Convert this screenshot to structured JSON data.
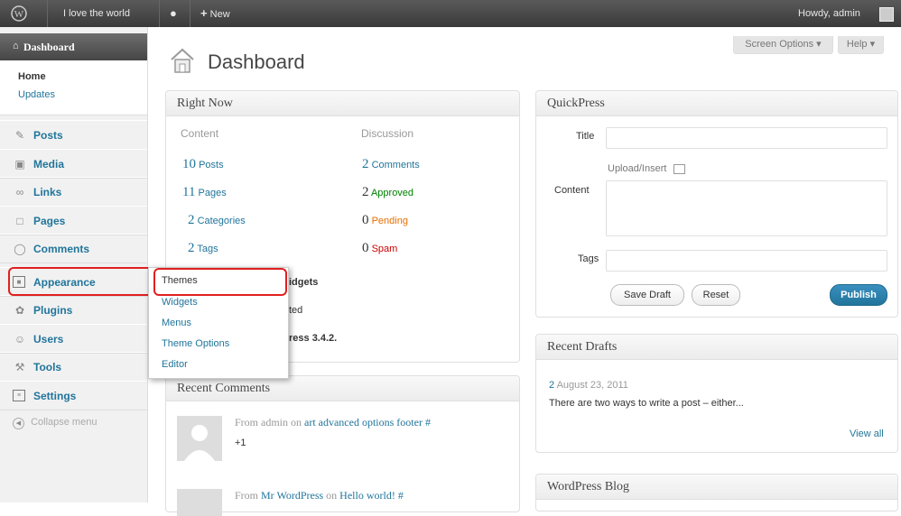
{
  "adminbar": {
    "site_name": "I love the world",
    "new_label": "New",
    "howdy": "Howdy, admin"
  },
  "header": {
    "title": "Dashboard",
    "screen_options": "Screen Options ▾",
    "help": "Help ▾"
  },
  "sidebar": {
    "dashboard": "Dashboard",
    "home": "Home",
    "updates": "Updates",
    "items": [
      {
        "label": "Posts",
        "icon": "posts-icon"
      },
      {
        "label": "Media",
        "icon": "media-icon"
      },
      {
        "label": "Links",
        "icon": "links-icon"
      },
      {
        "label": "Pages",
        "icon": "pages-icon"
      },
      {
        "label": "Comments",
        "icon": "comments-icon"
      },
      {
        "label": "Appearance",
        "icon": "appearance-icon"
      },
      {
        "label": "Plugins",
        "icon": "plugins-icon"
      },
      {
        "label": "Users",
        "icon": "users-icon"
      },
      {
        "label": "Tools",
        "icon": "tools-icon"
      },
      {
        "label": "Settings",
        "icon": "settings-icon"
      }
    ],
    "collapse": "Collapse menu"
  },
  "flyout": {
    "items": [
      "Themes",
      "Widgets",
      "Menus",
      "Theme Options",
      "Editor"
    ]
  },
  "right_now": {
    "title": "Right Now",
    "content_heading": "Content",
    "discussion_heading": "Discussion",
    "content": [
      {
        "num": "10",
        "label": "Posts"
      },
      {
        "num": "11",
        "label": "Pages"
      },
      {
        "num": "2",
        "label": "Categories"
      },
      {
        "num": "2",
        "label": "Tags"
      }
    ],
    "discussion": [
      {
        "num": "2",
        "label": "Comments",
        "color": "#21759b"
      },
      {
        "num": "2",
        "label": "Approved",
        "color": "#008000"
      },
      {
        "num": "0",
        "label": "Pending",
        "color": "#e66f00"
      },
      {
        "num": "0",
        "label": "Spam",
        "color": "#cc0000"
      }
    ],
    "partial_widgets": "idgets",
    "partial_ted": "ted",
    "partial_version": "ress 3.4.2."
  },
  "recent_comments": {
    "title": "Recent Comments",
    "items": [
      {
        "from": "From admin on",
        "link": "art advanced options footer #",
        "extra": "+1"
      },
      {
        "from": "From",
        "author": "Mr WordPress",
        "on": "on",
        "link": "Hello world! #"
      }
    ]
  },
  "quickpress": {
    "title": "QuickPress",
    "title_label": "Title",
    "upload_insert": "Upload/Insert",
    "content_label": "Content",
    "tags_label": "Tags",
    "save_draft": "Save Draft",
    "reset": "Reset",
    "publish": "Publish"
  },
  "recent_drafts": {
    "title": "Recent Drafts",
    "item_link": "2",
    "item_date": "August 23, 2011",
    "item_excerpt": "There are two ways to write a post – either...",
    "view_all": "View all"
  },
  "wordpress_blog": {
    "title": "WordPress Blog"
  },
  "colors": {
    "link": "#21759b",
    "highlight": "#e02020",
    "publish": "#21759b"
  }
}
